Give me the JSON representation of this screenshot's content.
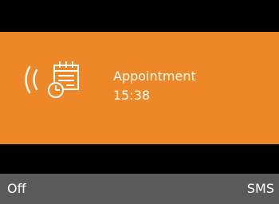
{
  "alert": {
    "title": "Appointment",
    "time": "15:38",
    "icon": "calendar-clock-icon",
    "ring_indicator": "ringing-waves-icon",
    "background_color": "#ee8727"
  },
  "softkeys": {
    "left_label": "Off",
    "right_label": "SMS",
    "bar_color": "#5a5a5a"
  }
}
